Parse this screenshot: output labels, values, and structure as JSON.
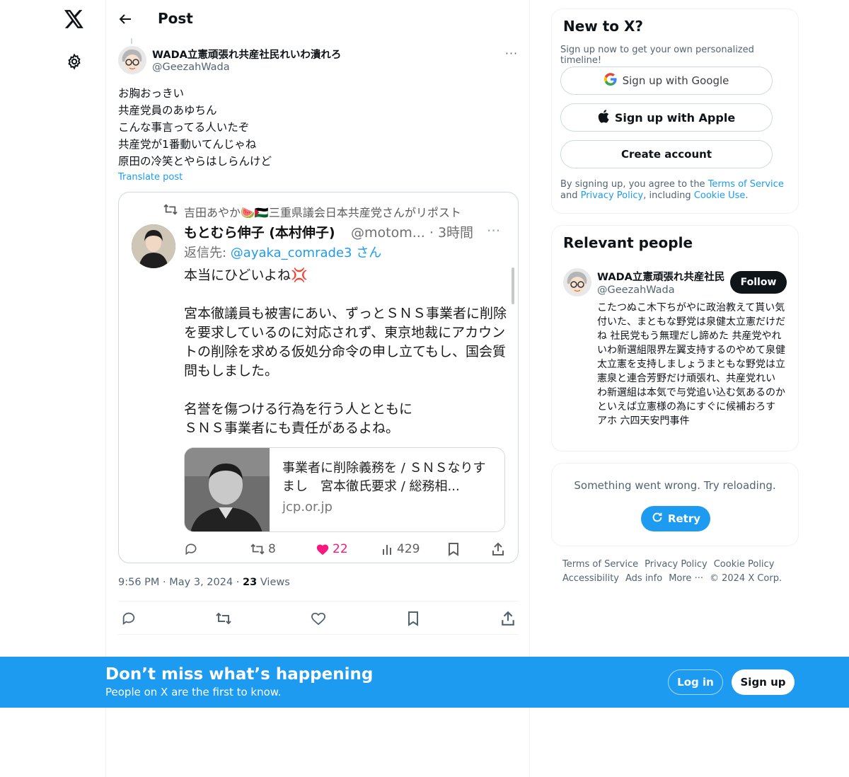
{
  "header": {
    "title": "Post"
  },
  "post": {
    "author_name": "WADA立憲頑張れ共産社民れいわ潰れろ",
    "author_handle": "@GeezahWada",
    "text_lines": [
      "お胸おっきい",
      "共産党員のあゆちん",
      "こんな事言ってる人いたぞ",
      "共産党が1番動いてんじゃね",
      "原田の冷笑とやらはしらんけど"
    ],
    "translate": "Translate post",
    "timestamp_time": "9:56 PM",
    "timestamp_date": "May 3, 2024",
    "views_count": "23",
    "views_label": "Views"
  },
  "embedded_screenshot": {
    "repost_line": "吉田あやか🍉🇵🇸三重県議会日本共産党さんがリポスト",
    "name": "もとむら伸子 (本村伸子)",
    "handle_time": "@motom... · 3時間",
    "reply_prefix": "返信先: ",
    "reply_mention": "@ayaka_comrade3 さん",
    "body": "本当にひどいよね💢\n\n宮本徹議員も被害にあい、ずっとＳＮＳ事業者に削除を要求しているのに対応されず、東京地裁にアカウントの削除を求める仮処分命令の申し立てもし、国会質問もしました。\n\n名誉を傷つける行為を行う人とともに\nＳＮＳ事業者にも責任があるよね。",
    "link_title": "事業者に削除義務を / ＳＮＳなりすまし　宮本徹氏要求 / 総務相...",
    "link_domain": "jcp.or.jp",
    "reposts": "8",
    "likes": "22",
    "views": "429"
  },
  "signup_card": {
    "title": "New to X?",
    "subtitle": "Sign up now to get your own personalized timeline!",
    "google": "Sign up with Google",
    "apple": "Sign up with Apple",
    "create": "Create account",
    "legal_prefix": "By signing up, you agree to the ",
    "terms": "Terms of Service",
    "and": " and ",
    "privacy": "Privacy Policy",
    "including": ", including ",
    "cookie": "Cookie Use",
    "period": "."
  },
  "relevant": {
    "title": "Relevant people",
    "name": "WADA立憲頑張れ共産社民",
    "handle": "@GeezahWada",
    "follow": "Follow",
    "bio": "こたつぬこ木下ちがやに政治教えて貰い気付いた、まともな野党は泉健太立憲だけだね 社民党もう無理だし諦めた 共産党やれいわ新選組限界左翼支持するのやめて泉健太立憲を支持しましょうまともな野党は立憲泉と連合芳野だけ頑張れ、共産党れいわ新選組は本気で与党追い込む気あるのかといえば立憲様の為にすぐに候補おろすアホ 六四天安門事件"
  },
  "error_card": {
    "message": "Something went wrong. Try reloading.",
    "retry": "Retry"
  },
  "footer": {
    "links": [
      "Terms of Service",
      "Privacy Policy",
      "Cookie Policy",
      "Accessibility",
      "Ads info",
      "More ···",
      "© 2024 X Corp."
    ]
  },
  "banner": {
    "title": "Don’t miss what’s happening",
    "subtitle": "People on X are the first to know.",
    "login": "Log in",
    "signup": "Sign up"
  },
  "colors": {
    "accent": "#1d9bf0",
    "text": "#0f1419",
    "muted": "#536471",
    "like": "#f91880"
  }
}
